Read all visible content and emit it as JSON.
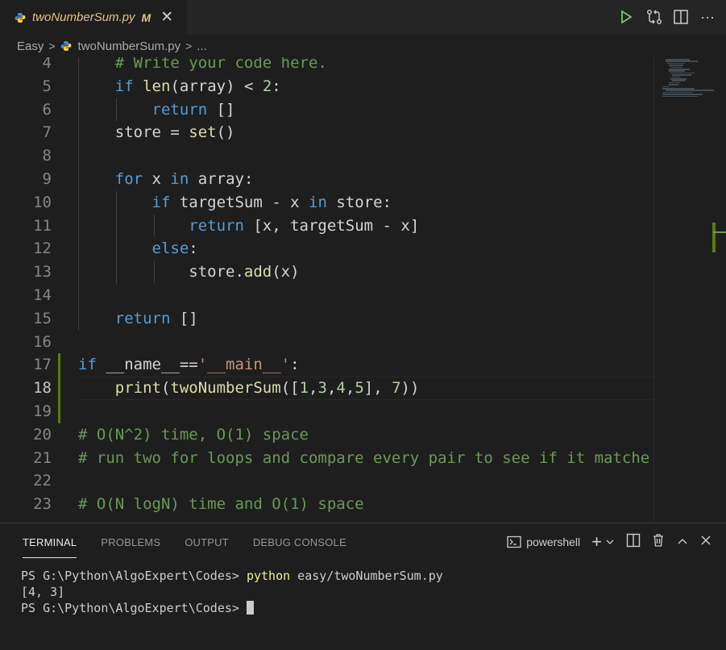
{
  "tab": {
    "file_name": "twoNumberSum.py",
    "modified_flag": "M",
    "close_glyph": "✕",
    "file_icon": "python-icon"
  },
  "editor_actions": {
    "run_icon": "play-icon",
    "compare_icon": "git-compare-icon",
    "split_icon": "split-editor-icon",
    "more_label": "···"
  },
  "breadcrumb": {
    "folder": "Easy",
    "file": "twoNumberSum.py",
    "more": "..."
  },
  "code_lines": [
    {
      "n": "4",
      "text": "    # Write your code here."
    },
    {
      "n": "5",
      "text": "    if len(array) < 2:"
    },
    {
      "n": "6",
      "text": "        return []"
    },
    {
      "n": "7",
      "text": "    store = set()"
    },
    {
      "n": "8",
      "text": ""
    },
    {
      "n": "9",
      "text": "    for x in array:"
    },
    {
      "n": "10",
      "text": "        if targetSum - x in store:"
    },
    {
      "n": "11",
      "text": "            return [x, targetSum - x]"
    },
    {
      "n": "12",
      "text": "        else:"
    },
    {
      "n": "13",
      "text": "            store.add(x)"
    },
    {
      "n": "14",
      "text": ""
    },
    {
      "n": "15",
      "text": "    return []"
    },
    {
      "n": "16",
      "text": ""
    },
    {
      "n": "17",
      "text": "if __name__=='__main__':"
    },
    {
      "n": "18",
      "text": "    print(twoNumberSum([1,3,4,5], 7))"
    },
    {
      "n": "19",
      "text": ""
    },
    {
      "n": "20",
      "text": "# O(N^2) time, O(1) space"
    },
    {
      "n": "21",
      "text": "# run two for loops and compare every pair to see if it matche"
    },
    {
      "n": "22",
      "text": ""
    },
    {
      "n": "23",
      "text": "# O(N logN) time and O(1) space"
    }
  ],
  "active_line": "18",
  "panel": {
    "tabs": [
      "TERMINAL",
      "PROBLEMS",
      "OUTPUT",
      "DEBUG CONSOLE"
    ],
    "active_tab": "TERMINAL",
    "shell_name": "powershell",
    "add_label": "+",
    "dropdown_glyph": "⌄",
    "close_glyph": "✕",
    "maximize_glyph": "^"
  },
  "terminal": {
    "prompt1": "PS G:\\Python\\AlgoExpert\\Codes> ",
    "cmd_python": "python",
    "cmd_args": " easy/twoNumberSum.py",
    "output": "[4, 3]",
    "prompt2": "PS G:\\Python\\AlgoExpert\\Codes> "
  },
  "colors": {
    "editor_bg": "#1e1e1e",
    "keyword": "#569cd6",
    "control_keyword": "#c586c0",
    "comment": "#6a9955",
    "string": "#ce9178",
    "number": "#b5cea8",
    "function": "#dcdcaa",
    "modified": "#e2c08d",
    "gutter_added": "#587c0c"
  }
}
